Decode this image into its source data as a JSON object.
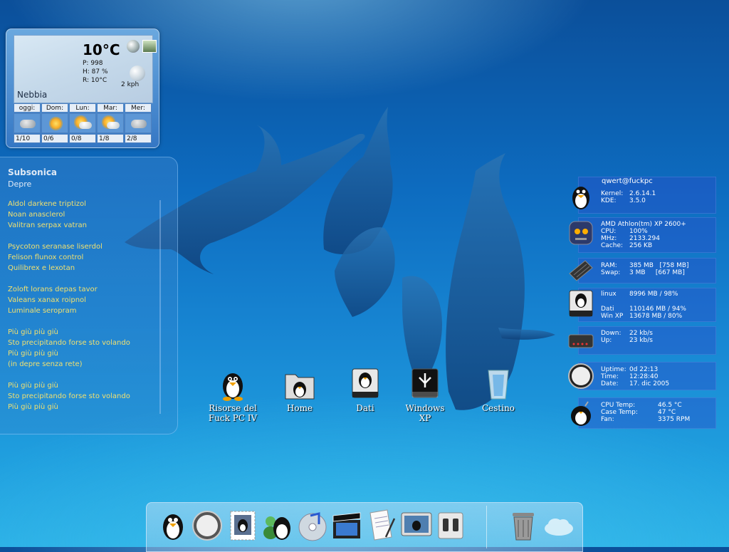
{
  "weather": {
    "temperature": "10°C",
    "pressure": "P: 998",
    "humidity": "H: 87 %",
    "real_feel": "R: 10°C",
    "wind": "2 kph",
    "condition": "Nebbia",
    "days": [
      {
        "name": "oggi:",
        "value": "1/10",
        "icon": "cloud-icon"
      },
      {
        "name": "Dom:",
        "value": "0/6",
        "icon": "sun-icon"
      },
      {
        "name": "Lun:",
        "value": "0/8",
        "icon": "sun-cloud-icon"
      },
      {
        "name": "Mar:",
        "value": "1/8",
        "icon": "sun-cloud-icon"
      },
      {
        "name": "Mer:",
        "value": "2/8",
        "icon": "cloud-icon"
      }
    ]
  },
  "lyrics": {
    "artist": "Subsonica",
    "song": "Depre",
    "lines": [
      "Aldol darkene triptizol",
      "Noan anasclerol",
      "Valitran serpax vatran",
      "",
      "Psycoton seranase liserdol",
      "Felison flunox control",
      "Quilibrex e lexotan",
      "",
      "Zoloft lorans depas tavor",
      "Valeans xanax roipnol",
      "Luminale seropram",
      "",
      "Più giù più giù",
      "Sto precipitando forse sto volando",
      "Più giù più giù",
      "(in depre senza rete)",
      "",
      "Più giù più giù",
      "Sto precipitando forse sto volando",
      "Più giù più giù"
    ]
  },
  "desktop_icons": [
    {
      "label_1": "Risorse del",
      "label_2": "Fuck PC IV"
    },
    {
      "label_1": "Home",
      "label_2": ""
    },
    {
      "label_1": "Dati",
      "label_2": ""
    },
    {
      "label_1": "Windows",
      "label_2": "XP"
    },
    {
      "label_1": "Cestino",
      "label_2": ""
    }
  ],
  "sysmon": {
    "user": "qwert@fuckpc",
    "kernel_label": "Kernel:",
    "kernel": "2.6.14.1",
    "kde_label": "KDE:",
    "kde": "3.5.0",
    "cpu_name": "AMD Athlon(tm) XP 2600+",
    "cpu_label": "CPU:",
    "cpu": "100%",
    "mhz_label": "MHz:",
    "mhz": "2133.294",
    "cache_label": "Cache:",
    "cache": "256 KB",
    "ram_label": "RAM:",
    "ram": "385 MB   [758 MB]",
    "swap_label": "Swap:",
    "swap": "3 MB     [667 MB]",
    "linux_label": "linux",
    "linux": "8996 MB / 98%",
    "dati_label": "Dati",
    "dati": "110146 MB / 94%",
    "winxp_label": "Win XP",
    "winxp": "13678 MB / 80%",
    "down_label": "Down:",
    "down": "22 kb/s",
    "up_label": "Up:",
    "up": "23 kb/s",
    "uptime_label": "Uptime:",
    "uptime": "0d 22:13",
    "time_label": "Time:",
    "time": "12:28:40",
    "date_label": "Date:",
    "date": "17. dic 2005",
    "cputemp_label": "CPU Temp:",
    "cputemp": "46.5 °C",
    "casetemp_label": "Case Temp:",
    "casetemp": "47 °C",
    "fan_label": "Fan:",
    "fan": "3375 RPM"
  },
  "dock": {
    "items": [
      "tux-finder-icon",
      "safari-compass-icon",
      "mail-stamp-icon",
      "messenger-icon",
      "itunes-icon",
      "video-clapper-icon",
      "text-editor-icon",
      "screen-monitor-icon",
      "switch-icon"
    ],
    "trash": "trash-icon"
  },
  "colors": {
    "lyrics_text": "#f0e070",
    "panel_blue": "#3577c4"
  }
}
